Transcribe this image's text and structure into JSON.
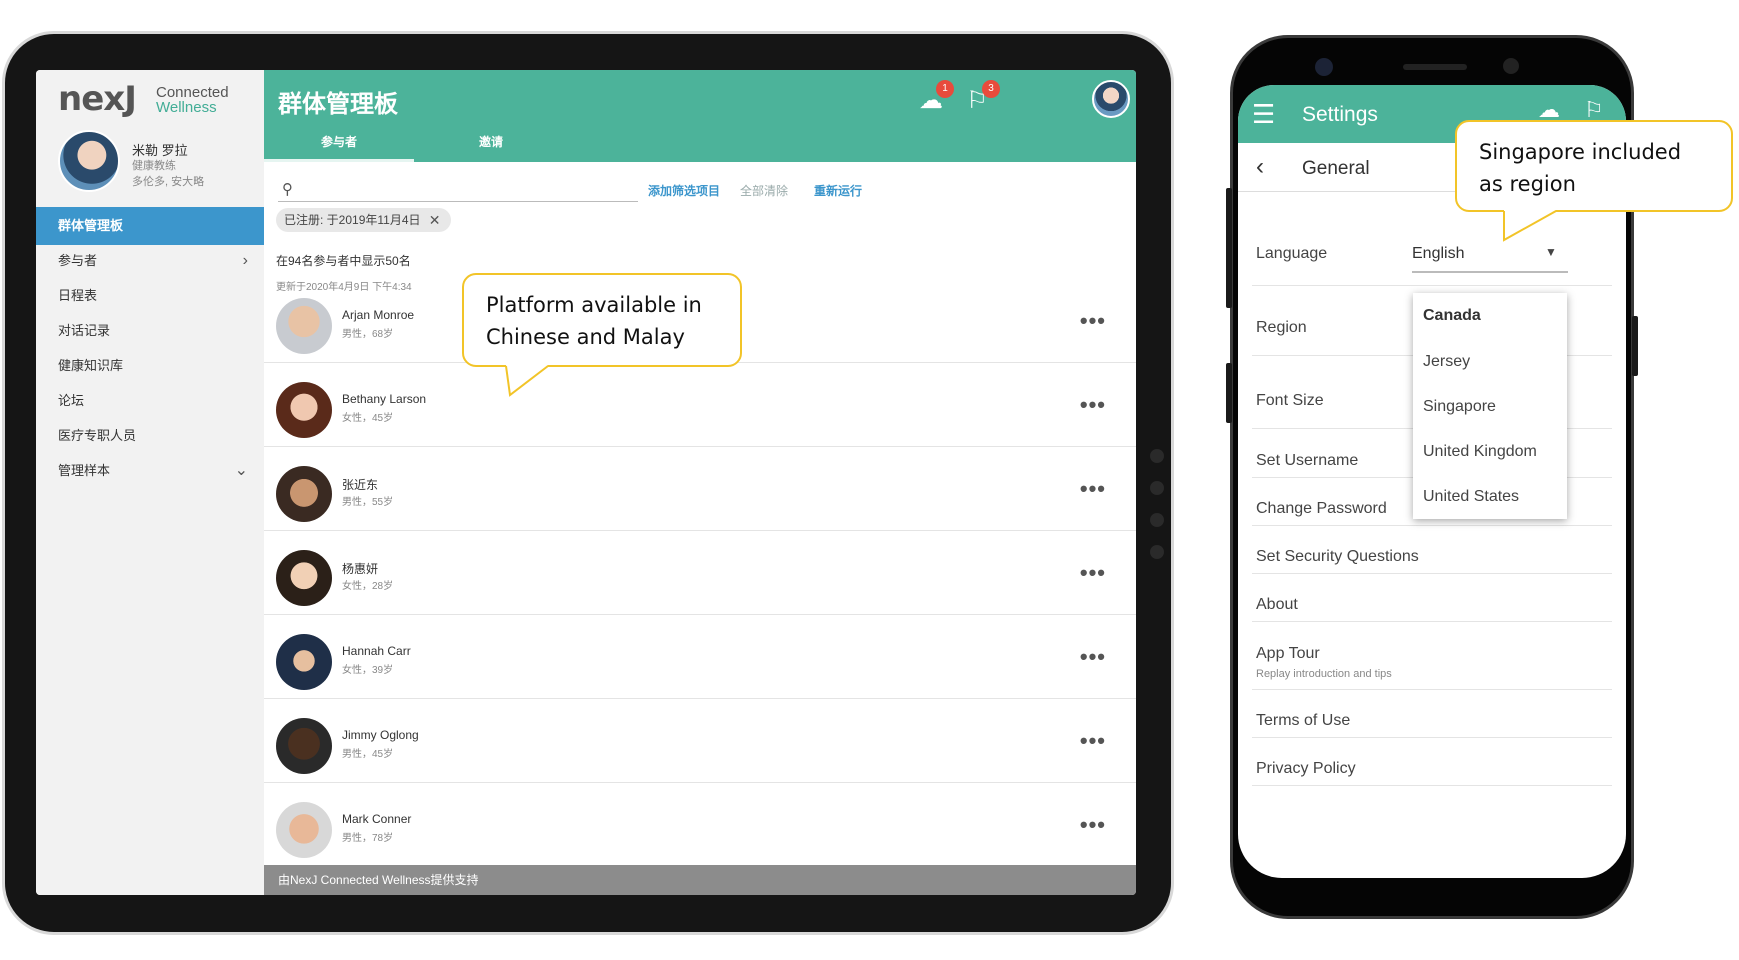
{
  "tablet": {
    "logo": {
      "brand": "nexJ",
      "sub1": "Connected",
      "sub2": "Wellness"
    },
    "profile": {
      "name": "米勒 罗拉",
      "role": "健康教练",
      "location": "多伦多, 安大略"
    },
    "sidebar": {
      "items": [
        {
          "label": "群体管理板"
        },
        {
          "label": "参与者"
        },
        {
          "label": "日程表"
        },
        {
          "label": "对话记录"
        },
        {
          "label": "健康知识库"
        },
        {
          "label": "论坛"
        },
        {
          "label": "医疗专职人员"
        },
        {
          "label": "管理样本"
        }
      ]
    },
    "header": {
      "title": "群体管理板",
      "tabs": [
        {
          "label": "参与者"
        },
        {
          "label": "邀请"
        }
      ],
      "badge_chat": "1",
      "badge_flag": "3"
    },
    "filters": {
      "search_placeholder": "",
      "add_filter": "添加筛选项目",
      "clear_all": "全部清除",
      "rerun": "重新运行",
      "chip": "已注册: 于2019年11月4日"
    },
    "summary": {
      "count": "在94名参与者中显示50名",
      "updated": "更新于2020年4月9日 下午4:34"
    },
    "participants": [
      {
        "name": "Arjan Monroe",
        "meta": "男性，68岁"
      },
      {
        "name": "Bethany Larson",
        "meta": "女性，45岁"
      },
      {
        "name": "张近东",
        "meta": "男性，55岁"
      },
      {
        "name": "杨惠妍",
        "meta": "女性，28岁"
      },
      {
        "name": "Hannah Carr",
        "meta": "女性，39岁"
      },
      {
        "name": "Jimmy Oglong",
        "meta": "男性，45岁"
      },
      {
        "name": "Mark Conner",
        "meta": "男性，78岁"
      }
    ],
    "more_glyph": "•••",
    "footer": "由NexJ Connected Wellness提供支持"
  },
  "callouts": {
    "tablet_line1": "Platform available in",
    "tablet_line2": "Chinese and Malay",
    "phone_line1": "Singapore included",
    "phone_line2": "as region"
  },
  "phone": {
    "title": "Settings",
    "section": "General",
    "language": {
      "label": "Language",
      "value": "English"
    },
    "region": {
      "label": "Region",
      "options": [
        "Canada",
        "Jersey",
        "Singapore",
        "United Kingdom",
        "United States"
      ],
      "selected": "Canada"
    },
    "items": {
      "font_size": "Font Size",
      "set_username": "Set Username",
      "change_password": "Change Password",
      "security_questions": "Set Security Questions",
      "about": "About",
      "app_tour": "App Tour",
      "app_tour_sub": "Replay introduction and tips",
      "terms": "Terms of Use",
      "privacy": "Privacy Policy"
    }
  },
  "colors": {
    "accent": "#4cb39a",
    "nav_active": "#3c96cc",
    "callout_border": "#f2c428",
    "badge": "#e84b3c"
  }
}
